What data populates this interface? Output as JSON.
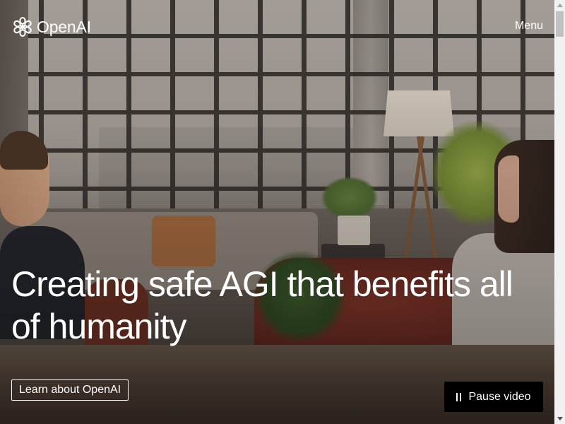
{
  "header": {
    "logo_text": "OpenAI",
    "logo_icon": "openai-blossom-icon",
    "menu_label": "Menu"
  },
  "hero": {
    "headline": "Creating safe AGI that benefits all of humanity",
    "learn_button_label": "Learn about OpenAI",
    "pause_button_label": "Pause video",
    "pause_icon": "pause-icon",
    "background": "video-frame: two people talking in a loft living room"
  },
  "colors": {
    "text": "#ffffff",
    "pause_button_bg": "#000000",
    "scrollbar_track": "#f1f1f1",
    "scrollbar_thumb": "#c1c1c1"
  },
  "scrollbar": {
    "position_fraction": 0
  }
}
